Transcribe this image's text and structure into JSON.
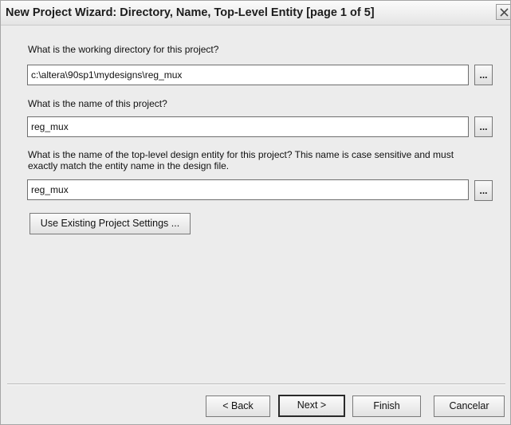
{
  "window": {
    "title": "New Project Wizard: Directory, Name, Top-Level Entity [page 1 of 5]",
    "close_icon": "close-icon"
  },
  "form": {
    "directory_prompt": "What is the working directory for this project?",
    "directory_value": "c:\\altera\\90sp1\\mydesigns\\reg_mux",
    "name_prompt": "What is the name of this project?",
    "name_value": "reg_mux",
    "entity_prompt_line1": "What is the name of the top-level design entity for this project? This name is case sensitive and must",
    "entity_prompt_line2": "exactly match the entity name in the design file.",
    "entity_value": "reg_mux",
    "browse_label": "...",
    "existing_settings_label": "Use Existing Project Settings ..."
  },
  "footer": {
    "back_label": "< Back",
    "next_label": "Next >",
    "finish_label": "Finish",
    "cancel_label": "Cancelar"
  }
}
